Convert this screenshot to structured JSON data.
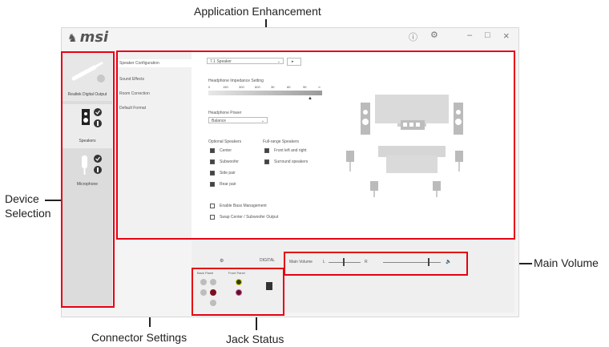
{
  "annotations": {
    "application_enhancement": "Application Enhancement",
    "device_selection_line1": "Device",
    "device_selection_line2": "Selection",
    "main_volume": "Main Volume",
    "connector_settings": "Connector Settings",
    "jack_status": "Jack Status"
  },
  "app": {
    "logo": "msi",
    "info_icon": "info-icon",
    "settings_icon": "gear-icon",
    "minimize": "–",
    "maximize": "□",
    "close": "×"
  },
  "devices": [
    {
      "label": "Realtek Digital Output"
    },
    {
      "label": "Speakers"
    },
    {
      "label": "Microphone"
    }
  ],
  "nav": [
    {
      "label": "Speaker Configuration"
    },
    {
      "label": "Sound Effects"
    },
    {
      "label": "Room Correction"
    },
    {
      "label": "Default Format"
    }
  ],
  "speaker_config": {
    "config_select": "7.1 Speaker",
    "impedance_label": "Headphone Impedance Setting",
    "impedance_ticks": [
      "0",
      "150",
      "300",
      "600",
      "3K",
      "6K",
      "9K",
      "∞"
    ],
    "power_label": "Headphone Power",
    "power_select": "Balance",
    "optional_label": "Optional Speakers",
    "optional": [
      "Center",
      "Subwoofer",
      "Side pair",
      "Rear pair"
    ],
    "fullrange_label": "Full-range Speakers",
    "fullrange": [
      "Front left and right",
      "Surround speakers"
    ],
    "bass_label": "Enable Bass Management",
    "swap_label": "Swap Center / Subwoofer Output"
  },
  "bottom": {
    "digital_label": "DIGITAL",
    "volume_label": "Main Volume",
    "vol_left": "L",
    "vol_right": "R",
    "volume_level": 0.78,
    "balance_level": 0.45,
    "back_panel_label": "Back Panel",
    "front_panel_label": "Front Panel"
  }
}
